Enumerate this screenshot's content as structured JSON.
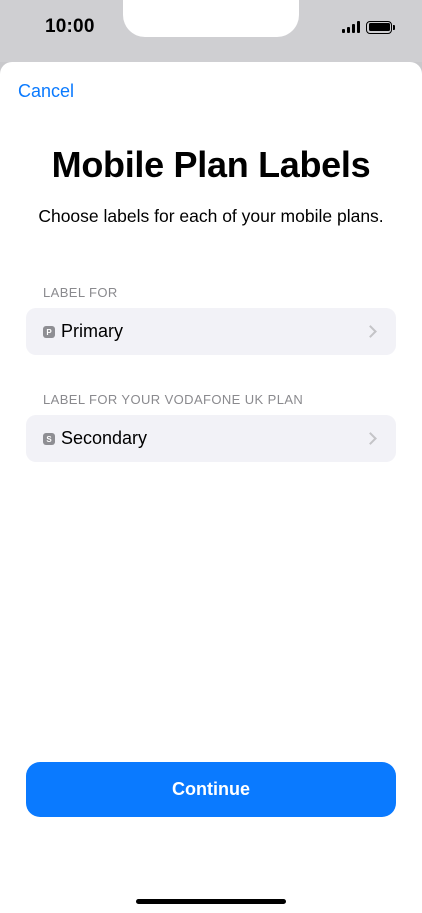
{
  "status_bar": {
    "time": "10:00",
    "signal_icon": "signal-bars-icon",
    "battery_icon": "battery-full-icon"
  },
  "nav": {
    "cancel_label": "Cancel"
  },
  "header": {
    "title": "Mobile Plan Labels",
    "subtitle": "Choose labels for each of your mobile plans."
  },
  "plans": [
    {
      "section_label": "LABEL FOR",
      "badge": "P",
      "label": "Primary"
    },
    {
      "section_label": "LABEL FOR YOUR VODAFONE UK PLAN",
      "badge": "S",
      "label": "Secondary"
    }
  ],
  "footer": {
    "continue_label": "Continue"
  },
  "colors": {
    "accent": "#0a7aff",
    "row_background": "#f2f2f7",
    "secondary_text": "#8a8a8e"
  }
}
